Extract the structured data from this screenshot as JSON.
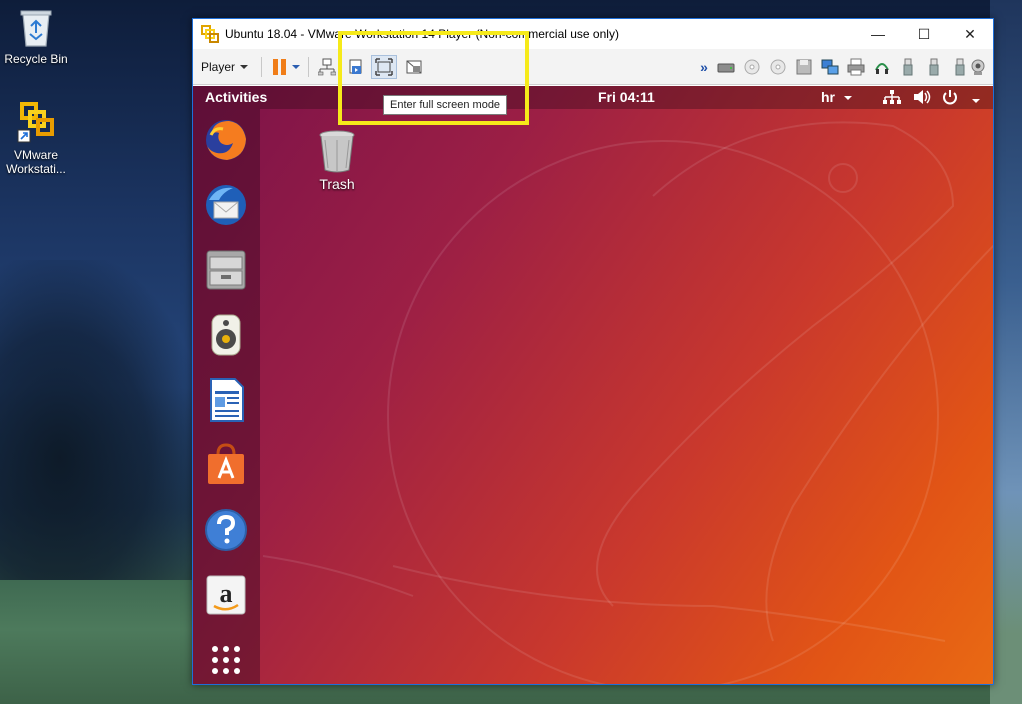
{
  "desktop": {
    "icons": [
      {
        "label": "Recycle Bin"
      },
      {
        "label": "VMware Workstati..."
      }
    ]
  },
  "window": {
    "title": "Ubuntu 18.04 - VMware Workstation 14 Player (Non-commercial use only)",
    "controls": {
      "minimize": "—",
      "maximize": "☐",
      "close": "✕"
    }
  },
  "toolbar": {
    "player_label": "Player",
    "tooltip": "Enter full screen mode",
    "more_label": "»"
  },
  "guest": {
    "activities": "Activities",
    "clock": "Fri 04:11",
    "keyboard_layout": "hr",
    "desktop_trash_label": "Trash",
    "dock_items": [
      "firefox-icon",
      "thunderbird-icon",
      "files-icon",
      "rhythmbox-icon",
      "libreoffice-writer-icon",
      "ubuntu-software-icon",
      "help-icon",
      "amazon-icon",
      "show-applications-icon"
    ]
  },
  "colors": {
    "highlight": "#f6ea1a",
    "ubuntu_orange": "#e95420",
    "titlebar_accent": "#1e6fd9"
  }
}
